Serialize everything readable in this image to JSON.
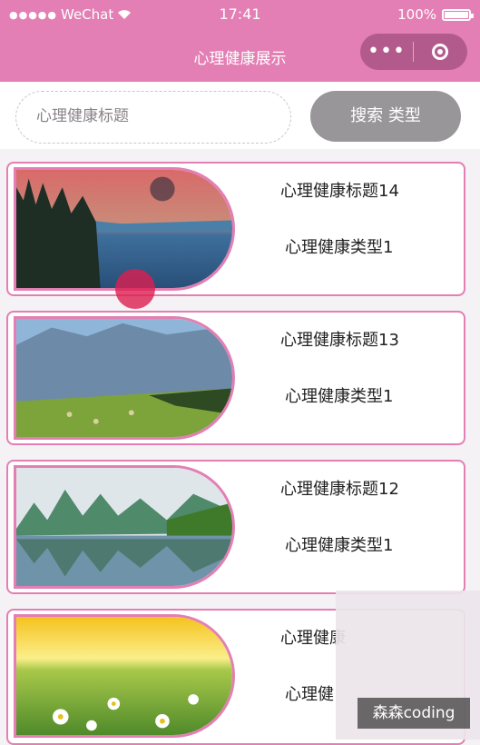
{
  "status_bar": {
    "signal_dots": "●●●●●",
    "carrier": "WeChat",
    "wifi_icon": "wifi-icon",
    "time": "17:41",
    "battery": "100%"
  },
  "nav": {
    "title": "心理健康展示",
    "more_glyph": "•••"
  },
  "search": {
    "placeholder": "心理健康标题",
    "button_label": "搜索  类型"
  },
  "cards": [
    {
      "title": "心理健康标题14",
      "type": "心理健康类型1",
      "image": "sunset-lake-image"
    },
    {
      "title": "心理健康标题13",
      "type": "心理健康类型1",
      "image": "mountain-meadow-image"
    },
    {
      "title": "心理健康标题12",
      "type": "心理健康类型1",
      "image": "karst-river-image"
    },
    {
      "title": "心理健康",
      "type": "心理健",
      "image": "daisy-field-image"
    }
  ],
  "watermark": "森森coding"
}
